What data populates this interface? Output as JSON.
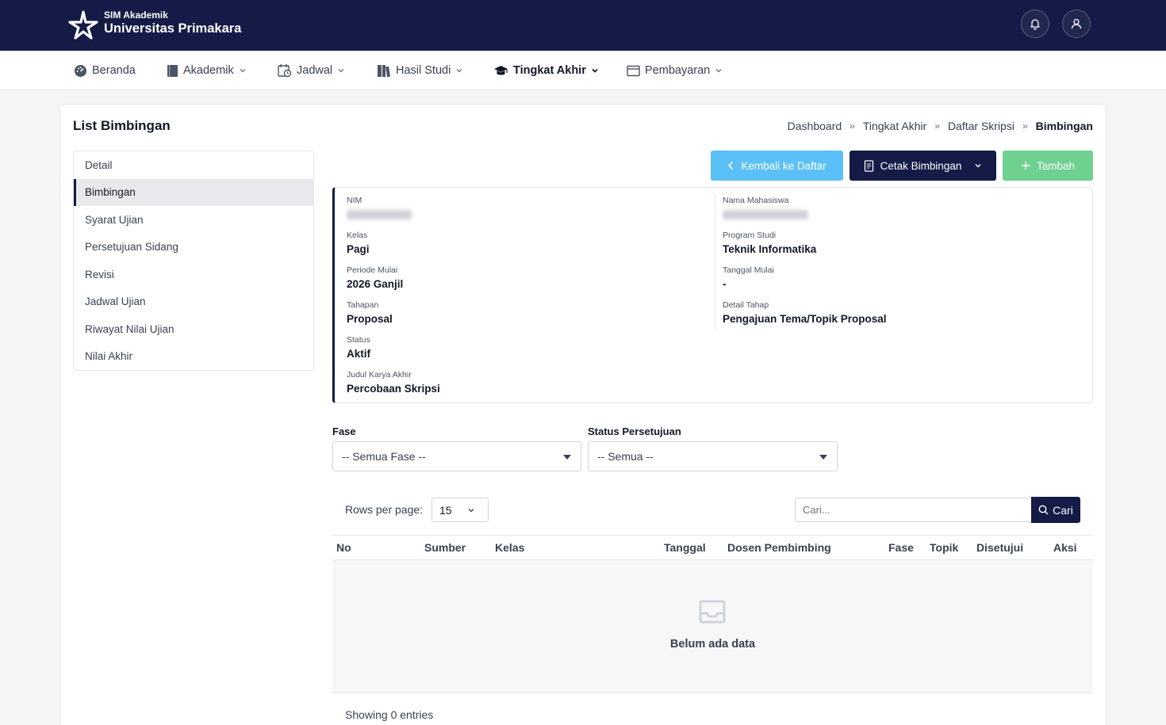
{
  "header": {
    "subtitle": "SIM Akademik",
    "title": "Universitas Primakara"
  },
  "nav": {
    "items": [
      {
        "label": "Beranda"
      },
      {
        "label": "Akademik"
      },
      {
        "label": "Jadwal"
      },
      {
        "label": "Hasil Studi"
      },
      {
        "label": "Tingkat Akhir"
      },
      {
        "label": "Pembayaran"
      }
    ]
  },
  "page": {
    "title": "List Bimbingan",
    "breadcrumb": [
      "Dashboard",
      "Tingkat Akhir",
      "Daftar Skripsi",
      "Bimbingan"
    ]
  },
  "sidebar": {
    "items": [
      {
        "label": "Detail"
      },
      {
        "label": "Bimbingan"
      },
      {
        "label": "Syarat Ujian"
      },
      {
        "label": "Persetujuan Sidang"
      },
      {
        "label": "Revisi"
      },
      {
        "label": "Jadwal Ujian"
      },
      {
        "label": "Riwayat Nilai Ujian"
      },
      {
        "label": "Nilai Akhir"
      }
    ],
    "active_index": 1
  },
  "actions": {
    "back_label": "Kembali ke Daftar",
    "print_label": "Cetak Bimbingan",
    "add_label": "Tambah"
  },
  "info": {
    "nim_label": "NIM",
    "nama_label": "Nama Mahasiswa",
    "kelas_label": "Kelas",
    "kelas_value": "Pagi",
    "prodi_label": "Program Studi",
    "prodi_value": "Teknik Informatika",
    "periode_label": "Periode Mulai",
    "periode_value": "2026 Ganjil",
    "tanggal_label": "Tanggal Mulai",
    "tanggal_value": "-",
    "tahapan_label": "Tahapan",
    "tahapan_value": "Proposal",
    "detail_tahap_label": "Detail Tahap",
    "detail_tahap_value": "Pengajuan Tema/Topik Proposal",
    "status_label": "Status",
    "status_value": "Aktif",
    "judul_label": "Judul Karya Akhir",
    "judul_value": "Percobaan Skripsi"
  },
  "filters": {
    "fase_label": "Fase",
    "fase_value": "-- Semua Fase --",
    "status_label": "Status Persetujuan",
    "status_value": "-- Semua --"
  },
  "table": {
    "rows_per_page_label": "Rows per page:",
    "rows_per_page": "15",
    "search_placeholder": "Cari...",
    "search_button": "Cari",
    "columns": [
      "No",
      "Sumber",
      "Kelas",
      "Tanggal",
      "Dosen Pembimbing",
      "Fase",
      "Topik",
      "Disetujui",
      "Aksi"
    ],
    "empty_text": "Belum ada data",
    "footer": "Showing 0 entries"
  },
  "colors": {
    "primary": "#141b46",
    "info": "#5bc0f8",
    "success": "#6fd190"
  }
}
